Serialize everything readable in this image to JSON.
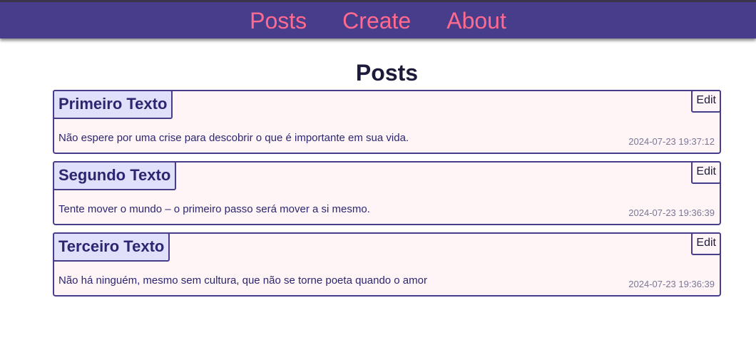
{
  "nav": {
    "items": [
      {
        "label": "Posts"
      },
      {
        "label": "Create"
      },
      {
        "label": "About"
      }
    ]
  },
  "page": {
    "title": "Posts"
  },
  "posts": [
    {
      "title": "Primeiro Texto",
      "body": "Não espere por uma crise para descobrir o que é importante em sua vida.",
      "timestamp": "2024-07-23 19:37:12",
      "edit_label": "Edit"
    },
    {
      "title": "Segundo Texto",
      "body": "Tente mover o mundo – o primeiro passo será mover a si mesmo.",
      "timestamp": "2024-07-23 19:36:39",
      "edit_label": "Edit"
    },
    {
      "title": "Terceiro Texto",
      "body": "Não há ninguém, mesmo sem cultura, que não se torne poeta quando o amor",
      "timestamp": "2024-07-23 19:36:39",
      "edit_label": "Edit"
    }
  ],
  "colors": {
    "navbar": "#483d8b",
    "nav_link": "#ff6a8e",
    "card_bg": "#fff5f7",
    "card_border": "#483d8b",
    "title_bg": "#e1e0fb"
  }
}
